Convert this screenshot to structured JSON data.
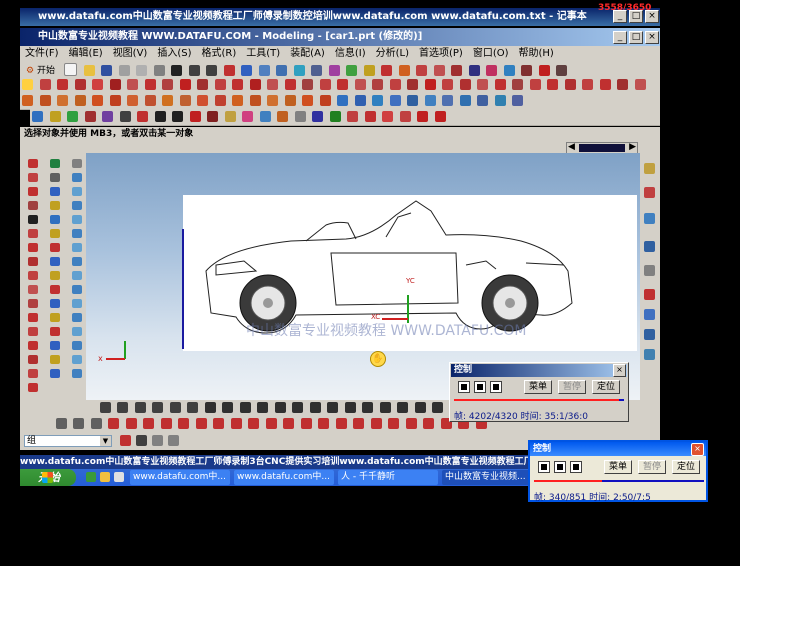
{
  "notepad": {
    "title": "www.datafu.com中山数富专业视频教程工厂师傅录制数控培训www.datafu.com www.datafu.com.txt - 记事本",
    "counter": "3558/3650",
    "min": "_",
    "max": "□",
    "close": "×"
  },
  "app": {
    "title": "中山数富专业视频教程 WWW.DATAFU.COM - Modeling - [car1.prt (修改的)]",
    "min": "_",
    "max": "□",
    "close": "×"
  },
  "menu": [
    "文件(F)",
    "编辑(E)",
    "视图(V)",
    "插入(S)",
    "格式(R)",
    "工具(T)",
    "装配(A)",
    "信息(I)",
    "分析(L)",
    "首选项(P)",
    "窗口(O)",
    "帮助(H)"
  ],
  "toolbar": {
    "start_label": "开始"
  },
  "prompt": "选择对象并使用 MB3，或者双击某一对象",
  "viewport": {
    "watermark": "中山数富专业视频教程 WWW.DATAFU.COM",
    "axis_labels": {
      "x": "x",
      "y": "Y",
      "xc": "XC",
      "yc": "YC"
    }
  },
  "command_combo": {
    "value": "组"
  },
  "marquee": "www.datafu.com中山数富专业视频教程工厂师傅录制3台CNC提供实习培训www.datafu.com中山数富专业视频教程工厂师傅录制",
  "taskbar": {
    "start": "开始",
    "tasks": [
      "www.datafu.com中...",
      "www.datafu.com中...",
      "人 - 千千静听",
      "中山数富专业视频..."
    ]
  },
  "control_panel_1": {
    "title": "控制",
    "close": "×",
    "menu_button": "菜单",
    "disabled_button": "暂停",
    "locate_button": "定位",
    "frame_label": "帧: 4202/4320",
    "time_label": "时间: 35:1/36:0",
    "progress": 0.973
  },
  "control_panel_2": {
    "title": "控制",
    "close": "×",
    "menu_button": "菜单",
    "disabled_button": "暂停",
    "locate_button": "定位",
    "frame_label": "帧: 340/851",
    "time_label": "时间: 2:50/7:5",
    "progress": 0.4
  },
  "colors": {
    "titlebar": "#0a246a",
    "chrome": "#d4d0c8",
    "taskbar": "#245dd7",
    "counter_red": "#ff2a2a"
  }
}
